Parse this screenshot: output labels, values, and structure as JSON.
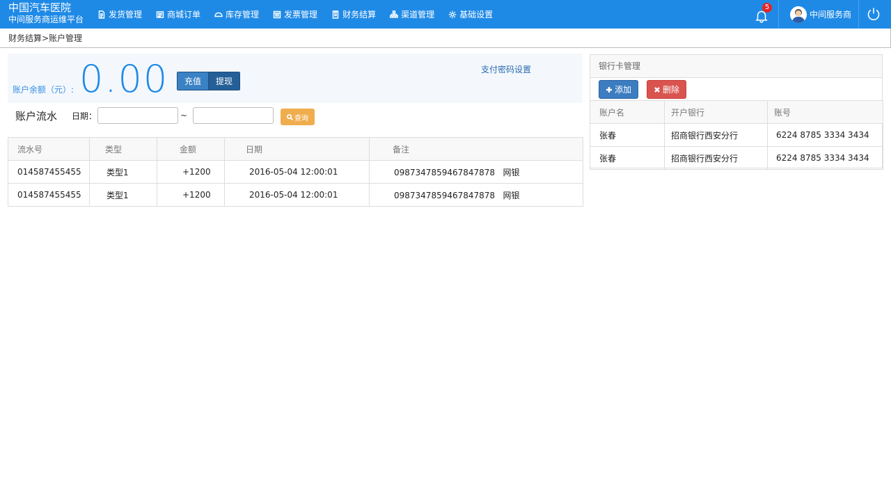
{
  "brand": {
    "name": "中国汽车医院",
    "subtitle": "中间服务商运维平台"
  },
  "nav": [
    {
      "label": "发货管理",
      "icon": "document-icon"
    },
    {
      "label": "商城订单",
      "icon": "order-list-icon"
    },
    {
      "label": "库存管理",
      "icon": "warehouse-icon"
    },
    {
      "label": "发票管理",
      "icon": "invoice-icon"
    },
    {
      "label": "财务结算",
      "icon": "finance-icon"
    },
    {
      "label": "渠道管理",
      "icon": "sitemap-icon"
    },
    {
      "label": "基础设置",
      "icon": "gear-icon"
    }
  ],
  "notifications": {
    "count": "5"
  },
  "user": {
    "name": "中间服务商"
  },
  "breadcrumb": "财务结算>账户管理",
  "balance": {
    "label": "账户余额（元）:",
    "value": "0.00",
    "recharge_label": "充值",
    "withdraw_label": "提现",
    "pay_password_link": "支付密码设置"
  },
  "flow": {
    "title": "账户流水",
    "date_label": "日期：",
    "start_date": "",
    "end_date": "",
    "separator": "~",
    "search_label": "查询",
    "columns": [
      "流水号",
      "类型",
      "金额",
      "日期",
      "备注"
    ],
    "rows": [
      [
        "014587455455",
        "类型1",
        "+1200",
        "2016-05-04 12:00:01",
        "0987347859467847878   网银"
      ],
      [
        "014587455455",
        "类型1",
        "+1200",
        "2016-05-04 12:00:01",
        "0987347859467847878   网银"
      ]
    ]
  },
  "bank": {
    "title": "银行卡管理",
    "add_label": "添加",
    "delete_label": "删除",
    "columns": [
      "账户名",
      "开户银行",
      "账号"
    ],
    "rows": [
      [
        "张春",
        "招商银行西安分行",
        "6224 8785 3334 3434"
      ],
      [
        "张春",
        "招商银行西安分行",
        "6224 8785 3334 3434"
      ]
    ]
  },
  "colors": {
    "topbar": "#1f8ae6",
    "balance_text": "#1f8ae6",
    "search_button": "#f0ad4e",
    "add_button": "#3c7cc0",
    "delete_button": "#d9534f"
  }
}
